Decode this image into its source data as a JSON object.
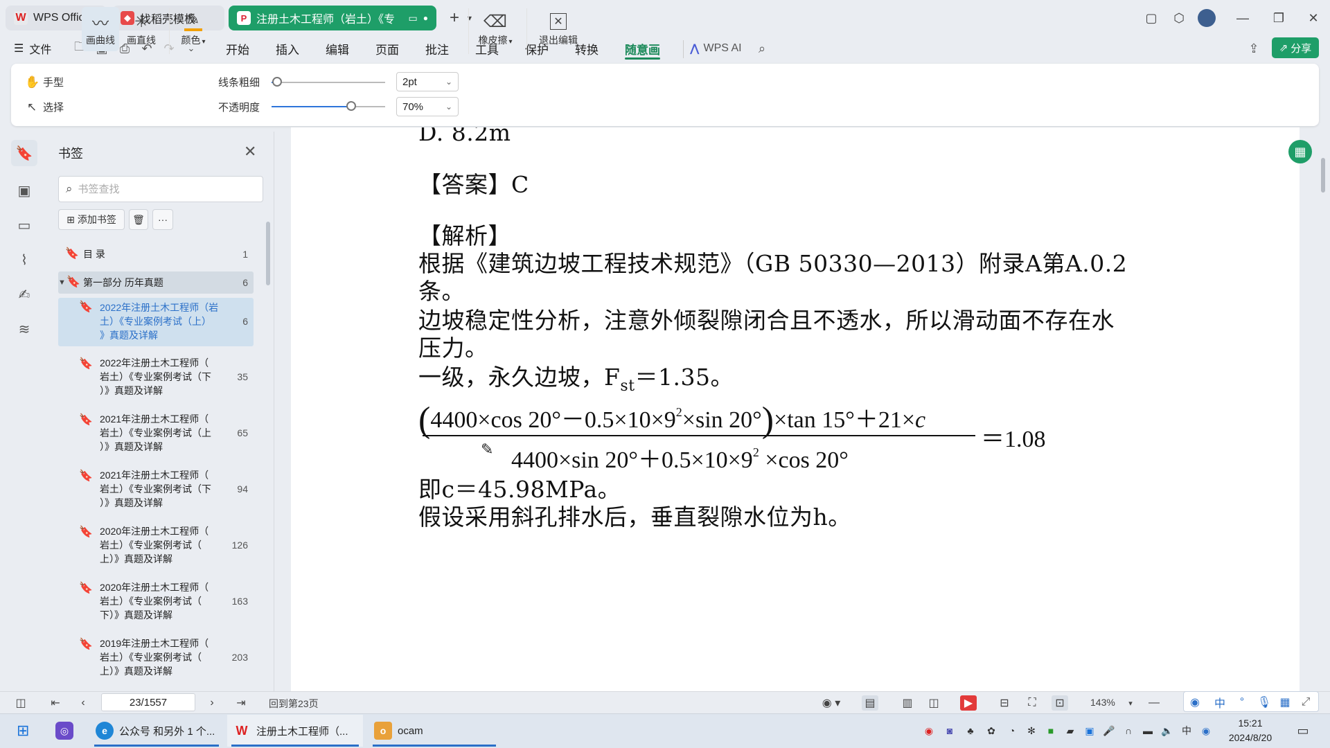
{
  "tabs": [
    {
      "label": "WPS Office",
      "icon": "wps-logo-icon"
    },
    {
      "label": "找稻壳模板",
      "icon": "docer-icon"
    },
    {
      "label": "注册土木工程师（岩土）《专",
      "icon": "pdf-icon"
    }
  ],
  "menu": {
    "file": "文件",
    "items": [
      "开始",
      "插入",
      "编辑",
      "页面",
      "批注",
      "工具",
      "保护",
      "转换",
      "随意画"
    ],
    "active": "随意画",
    "wps_ai": "WPS AI",
    "share": "分享"
  },
  "ribbon": {
    "hand": "手型",
    "select": "选择",
    "curve": "画曲线",
    "line": "画直线",
    "color": "颜色",
    "thickness_label": "线条粗细",
    "opacity_label": "不透明度",
    "thickness_value": "2pt",
    "opacity_value": "70%",
    "thickness_level": 0.05,
    "opacity_level": 0.7,
    "eraser": "橡皮擦",
    "exit": "退出编辑"
  },
  "bookmarks": {
    "title": "书签",
    "search_placeholder": "书签查找",
    "add_label": "添加书签",
    "items": [
      {
        "line1": "目 录",
        "line2": "",
        "line3": "",
        "page": "1"
      },
      {
        "line1": "第一部分 历年真题",
        "line2": "",
        "line3": "",
        "page": "6"
      },
      {
        "line1": "2022年注册土木工程师（岩",
        "line2": "土）《专业案例考试（上）",
        "line3": "》真题及详解",
        "page": "6"
      },
      {
        "line1": "2022年注册土木工程师（",
        "line2": "岩土）《专业案例考试（下",
        "line3": "）》真题及详解",
        "page": "35"
      },
      {
        "line1": "2021年注册土木工程师（",
        "line2": "岩土）《专业案例考试（上",
        "line3": "）》真题及详解",
        "page": "65"
      },
      {
        "line1": "2021年注册土木工程师（",
        "line2": "岩土）《专业案例考试（下",
        "line3": "）》真题及详解",
        "page": "94"
      },
      {
        "line1": "2020年注册土木工程师（",
        "line2": "岩土）《专业案例考试（",
        "line3": "上）》真题及详解",
        "page": "126"
      },
      {
        "line1": "2020年注册土木工程师（",
        "line2": "岩土）《专业案例考试（",
        "line3": "下）》真题及详解",
        "page": "163"
      },
      {
        "line1": "2019年注册土木工程师（",
        "line2": "岩土）《专业案例考试（",
        "line3": "上）》真题及详解",
        "page": "203"
      }
    ]
  },
  "document": {
    "option_d": "D.  8.2m",
    "answer": "【答案】C",
    "analysis_title": "【解析】",
    "l1": "根据《建筑边坡工程技术规范》（GB 50330—2013）附录A第A.0.2",
    "l2": "条。",
    "l3": "边坡稳定性分析，注意外倾裂隙闭合且不透水，所以滑动面不存在水",
    "l4": "压力。",
    "l5_pre": "一级，永久边坡，F",
    "l5_sub": "st",
    "l5_post": "＝1.35。",
    "f_num_a": "4400×cos 20°－0.5×10×9",
    "f_num_b": "×sin 20°",
    "f_num_c": "×tan 15°＋21×",
    "f_num_var": "c",
    "f_den_a": "4400×sin 20°＋0.5×10×9",
    "f_den_b": " ×cos 20°",
    "f_sup": "2",
    "f_result": "＝1.08",
    "l6": "即c＝45.98MPa。",
    "l7": "假设采用斜孔排水后，垂直裂隙水位为h。"
  },
  "status": {
    "page_value": "23/1557",
    "back_text": "回到第23页",
    "zoom": "143%"
  },
  "taskbar": {
    "apps": [
      {
        "label": "公众号 和另外 1 个...",
        "icon": "edge-icon"
      },
      {
        "label": "注册土木工程师（...",
        "icon": "wps-icon"
      },
      {
        "label": "ocam",
        "icon": "ocam-icon"
      }
    ],
    "time": "15:21",
    "date": "2024/8/20",
    "ime_lang": "中"
  },
  "colors": {
    "accent_green": "#1e9e68",
    "active_menu": "#1c8a5a",
    "selection_blue": "#2a6fc8"
  }
}
